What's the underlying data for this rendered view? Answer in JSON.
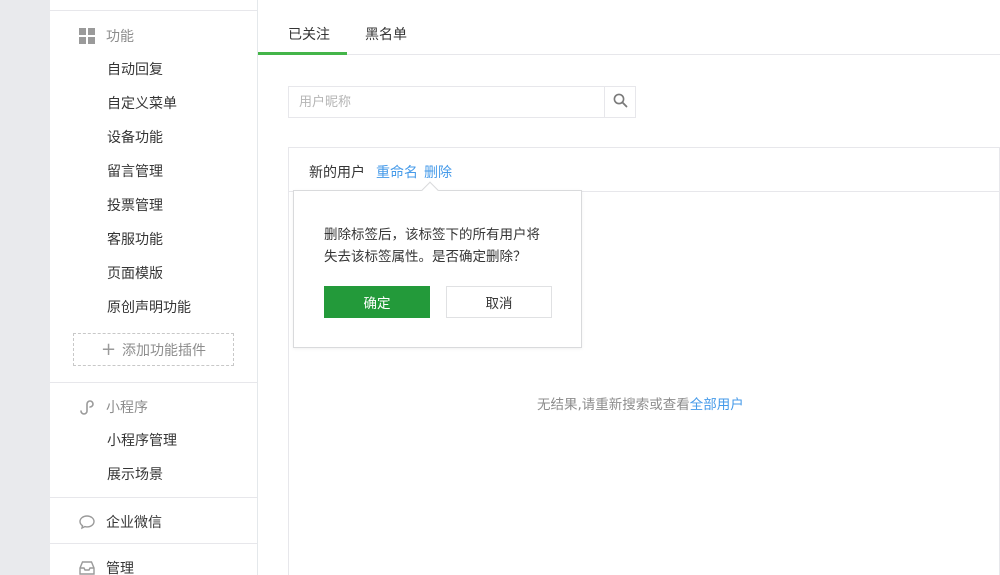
{
  "sidebar": {
    "features_title": "功能",
    "feature_items": [
      "自动回复",
      "自定义菜单",
      "设备功能",
      "留言管理",
      "投票管理",
      "客服功能",
      "页面模版",
      "原创声明功能"
    ],
    "add_plugin": "添加功能插件",
    "miniprogram_title": "小程序",
    "miniprogram_items": [
      "小程序管理",
      "展示场景"
    ],
    "wework": "企业微信",
    "manage": "管理"
  },
  "tabs": {
    "followed": "已关注",
    "blacklist": "黑名单"
  },
  "search": {
    "placeholder": "用户昵称"
  },
  "panel": {
    "tag_name": "新的用户",
    "rename": "重命名",
    "delete": "删除"
  },
  "popover": {
    "line1": "删除标签后，该标签下的所有用户将",
    "line2": "失去该标签属性。是否确定删除？",
    "confirm": "确定",
    "cancel": "取消"
  },
  "empty": {
    "text": "无结果,请重新搜索或查看",
    "link": "全部用户"
  },
  "colors": {
    "accent_green": "#44b549",
    "button_green": "#239a3a",
    "link_blue": "#459ae9"
  }
}
